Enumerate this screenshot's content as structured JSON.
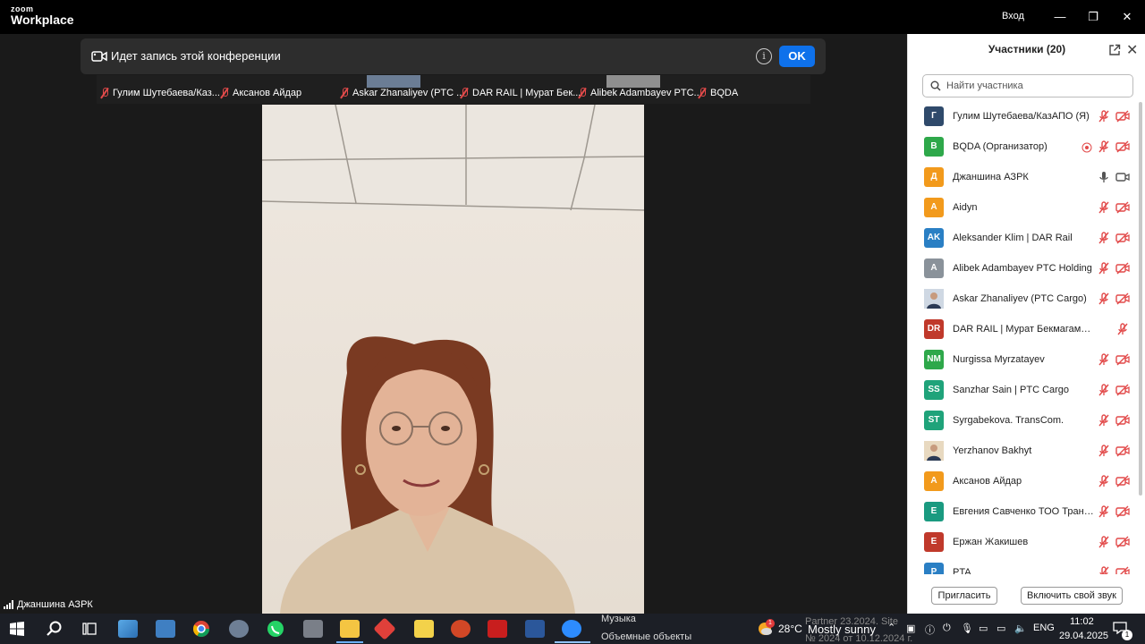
{
  "app": {
    "logo_line1": "zoom",
    "logo_line2": "Workplace",
    "signin": "Вход"
  },
  "window_controls": {
    "minimize": "—",
    "maximize": "❐",
    "close": "✕"
  },
  "recording_banner": {
    "text": "Идет запись этой конференции",
    "info": "i",
    "ok": "OK"
  },
  "thumbnail_strip": [
    {
      "name": "Гулим Шутебаева/Каз...",
      "muted": true
    },
    {
      "name": "Аксанов Айдар",
      "muted": true
    },
    {
      "name": "Askar Zhanaliyev (PTC ...",
      "muted": true
    },
    {
      "name": "DAR RAIL | Мурат Бек...",
      "muted": true
    },
    {
      "name": "Alibek Adambayev PTC...",
      "muted": true
    },
    {
      "name": "BQDA",
      "muted": true
    }
  ],
  "active_speaker": {
    "name": "Джаншина АЗРК"
  },
  "participants_panel": {
    "title": "Участники (20)",
    "search_placeholder": "Найти участника",
    "invite": "Пригласить",
    "unmute_self": "Включить свой звук",
    "participants": [
      {
        "initials": "Г",
        "name": "Гулим Шутебаева/КазАПО (Я)",
        "color": "#2f4a6b",
        "mic": "off",
        "video": "off"
      },
      {
        "initials": "B",
        "name": "BQDA (Организатор)",
        "color": "#2ea84a",
        "mic": "off",
        "video": "off",
        "recording": true
      },
      {
        "initials": "Д",
        "name": "Джаншина АЗРК",
        "color": "#f29a1c",
        "mic": "on",
        "video": "on"
      },
      {
        "initials": "A",
        "name": "Aidyn",
        "color": "#f29a1c",
        "mic": "off",
        "video": "off"
      },
      {
        "initials": "AK",
        "name": "Aleksander Klim | DAR Rail",
        "color": "#2a7fc4",
        "mic": "off",
        "video": "off"
      },
      {
        "initials": "A",
        "name": "Alibek Adambayev PTC Holding",
        "color": "#8a929a",
        "mic": "off",
        "video": "off"
      },
      {
        "initials": "",
        "name": "Askar Zhanaliyev (PTC Cargo)",
        "color": "#cfd8e3",
        "mic": "off",
        "video": "off",
        "photo": true
      },
      {
        "initials": "DR",
        "name": "DAR RAIL | Мурат Бекмагамбетов",
        "color": "#c0392b",
        "mic": "off",
        "video": "none"
      },
      {
        "initials": "NM",
        "name": "Nurgissa Myrzatayev",
        "color": "#2ea84a",
        "mic": "off",
        "video": "off"
      },
      {
        "initials": "SS",
        "name": "Sanzhar Sain | PTC Cargo",
        "color": "#1fa37a",
        "mic": "off",
        "video": "off"
      },
      {
        "initials": "ST",
        "name": "Syrgabekova. TransCom.",
        "color": "#1fa37a",
        "mic": "off",
        "video": "off"
      },
      {
        "initials": "",
        "name": "Yerzhanov Bakhyt",
        "color": "#e8d9c0",
        "mic": "off",
        "video": "off",
        "photo": true
      },
      {
        "initials": "A",
        "name": "Аксанов Айдар",
        "color": "#f29a1c",
        "mic": "off",
        "video": "off"
      },
      {
        "initials": "E",
        "name": "Евгения Савченко ТОО Транско...",
        "color": "#1a9a80",
        "mic": "off",
        "video": "off"
      },
      {
        "initials": "E",
        "name": "Ержан Жакишев",
        "color": "#c0392b",
        "mic": "off",
        "video": "off"
      },
      {
        "initials": "P",
        "name": "PTA",
        "color": "#2a7fc4",
        "mic": "off",
        "video": "off"
      }
    ]
  },
  "taskbar": {
    "items": [
      "windows-start",
      "search",
      "task-view",
      "pen",
      "calculator",
      "chrome",
      "network-app",
      "whatsapp",
      "printer",
      "file-explorer",
      "anydesk",
      "paint-app",
      "powerpoint",
      "acrobat",
      "word",
      "zoom"
    ],
    "behind_text_1": "Музыка",
    "behind_text_2": "Объемные объекты",
    "behind_text_3": "Partner 23.2024. Site",
    "behind_text_4": "№ 2024 от 10.12.2024 г.",
    "weather_badge": "1",
    "weather_temp": "28°C",
    "weather_desc": "Mostly sunny",
    "lang": "ENG",
    "time": "11:02",
    "date": "29.04.2025",
    "notif_count": "1"
  }
}
